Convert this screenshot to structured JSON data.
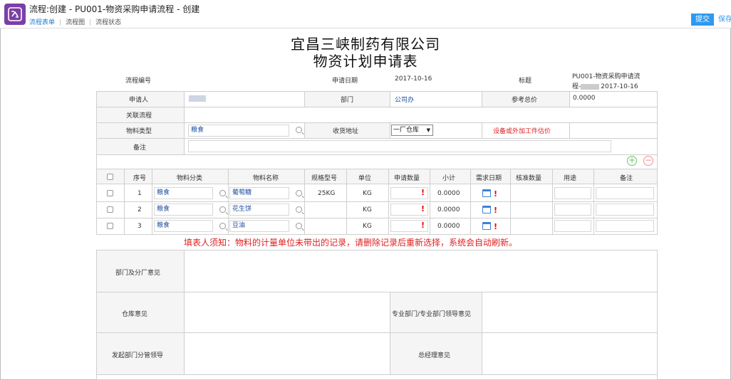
{
  "header": {
    "title": "流程:创建 - PU001-物资采购申请流程 - 创建",
    "tabs": [
      "流程表单",
      "流程图",
      "流程状态"
    ],
    "submit_label": "提交",
    "save_label": "保存"
  },
  "form": {
    "company": "宜昌三峡制药有限公司",
    "title": "物资计划申请表",
    "flow_no_label": "流程编号",
    "apply_date_label": "申请日期",
    "apply_date": "2017-10-16",
    "subject_label": "标题",
    "subject_line1": "PU001-物资采购申请流",
    "subject_line2_prefix": "程-",
    "subject_line2_date": "2017-10-16",
    "applicant_label": "申请人",
    "dept_label": "部门",
    "dept_value": "公司办",
    "ref_price_label": "参考总价",
    "ref_price_value": "0.0000",
    "related_flow_label": "关联流程",
    "material_type_label": "物料类型",
    "material_type_value": "粮食",
    "receive_addr_label": "收货地址",
    "receive_addr_value": "一厂仓库",
    "equipment_label": "设备或外加工件估价",
    "remark_label": "备注"
  },
  "table": {
    "columns": [
      "序号",
      "物料分类",
      "物料名称",
      "规格型号",
      "单位",
      "申请数量",
      "小计",
      "需求日期",
      "核准数量",
      "用途",
      "备注"
    ],
    "rows": [
      {
        "no": "1",
        "category": "粮食",
        "name": "葡萄糖",
        "spec": "25KG",
        "unit": "KG",
        "subtotal": "0.0000"
      },
      {
        "no": "2",
        "category": "粮食",
        "name": "花生饼",
        "spec": "",
        "unit": "KG",
        "subtotal": "0.0000"
      },
      {
        "no": "3",
        "category": "粮食",
        "name": "豆油",
        "spec": "",
        "unit": "KG",
        "subtotal": "0.0000"
      }
    ],
    "notice": "填表人须知：物料的计量单位未带出的记录，请删除记录后重新选择，系统会自动刷新。"
  },
  "opinions": {
    "dept_opinion": "部门及分厂意见",
    "warehouse_opinion": "仓库意见",
    "professional_opinion": "专业部门/专业部门领导意见",
    "initiator_leader": "发起部门分管领导",
    "gm_opinion": "总经理意见"
  },
  "colors": {
    "accent": "#2d9af0",
    "icon_bg": "#7b3fa7",
    "warning": "#e02020"
  }
}
